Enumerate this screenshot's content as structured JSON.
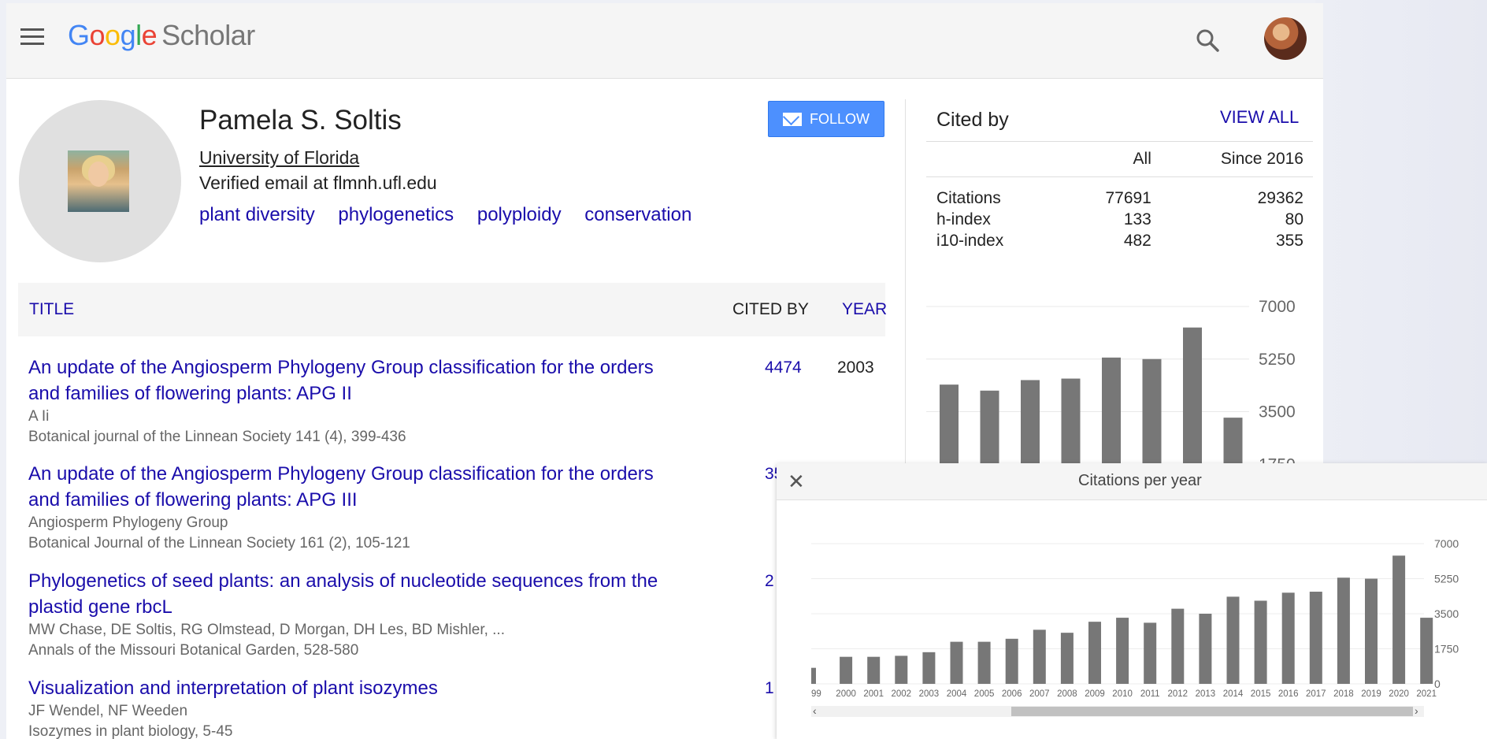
{
  "header": {
    "logo_google": [
      "G",
      "o",
      "o",
      "g",
      "l",
      "e"
    ],
    "logo_scholar": "Scholar"
  },
  "profile": {
    "name": "Pamela S. Soltis",
    "affiliation": "University of Florida",
    "email": "Verified email at flmnh.ufl.edu",
    "interests": [
      "plant diversity",
      "phylogenetics",
      "polyploidy",
      "conservation"
    ],
    "follow_label": "FOLLOW"
  },
  "articles_table": {
    "title_header": "TITLE",
    "cited_by_header": "CITED BY",
    "year_header": "YEAR",
    "rows": [
      {
        "title_line1": "An update of the Angiosperm Phylogeny Group classification for the orders",
        "title_line2": "and families of flowering plants: APG II",
        "authors": "A Ii",
        "venue": "Botanical journal of the Linnean Society 141 (4), 399-436",
        "cites": "4474",
        "year": "2003"
      },
      {
        "title_line1": "An update of the Angiosperm Phylogeny Group classification for the orders",
        "title_line2": "and families of flowering plants: APG III",
        "authors": "Angiosperm Phylogeny Group",
        "venue": "Botanical Journal of the Linnean Society 161 (2), 105-121",
        "cites": "35",
        "year": ""
      },
      {
        "title_line1": "Phylogenetics of seed plants: an analysis of nucleotide sequences from the",
        "title_line2": "plastid gene rbcL",
        "authors": "MW Chase, DE Soltis, RG Olmstead, D Morgan, DH Les, BD Mishler, ...",
        "venue": "Annals of the Missouri Botanical Garden, 528-580",
        "cites": "2",
        "year": ""
      },
      {
        "title_line1": "Visualization and interpretation of plant isozymes",
        "title_line2": "",
        "authors": "JF Wendel, NF Weeden",
        "venue": "Isozymes in plant biology, 5-45",
        "cites": "1",
        "year": ""
      }
    ]
  },
  "cited_by": {
    "title": "Cited by",
    "view_all": "VIEW ALL",
    "col_all": "All",
    "col_since": "Since 2016",
    "rows": [
      {
        "label": "Citations",
        "all": "77691",
        "since": "29362"
      },
      {
        "label": "h-index",
        "all": "133",
        "since": "80"
      },
      {
        "label": "i10-index",
        "all": "482",
        "since": "355"
      }
    ]
  },
  "popup": {
    "title": "Citations per year",
    "close_symbol": "✕",
    "scroll_left": "‹",
    "scroll_right": "›"
  },
  "chart_data": [
    {
      "type": "bar",
      "ylim": [
        0,
        7000
      ],
      "yticks": [
        7000,
        5250,
        3500,
        1750
      ],
      "values": [
        4400,
        4200,
        4550,
        4600,
        5300,
        5250,
        6300,
        3300
      ],
      "color": "#777777"
    },
    {
      "type": "bar",
      "title": "Citations per year",
      "ylim": [
        0,
        7000
      ],
      "yticks": [
        7000,
        5250,
        3500,
        1750,
        0
      ],
      "categories": [
        "99",
        "2000",
        "2001",
        "2002",
        "2003",
        "2004",
        "2005",
        "2006",
        "2007",
        "2008",
        "2009",
        "2010",
        "2011",
        "2012",
        "2013",
        "2014",
        "2015",
        "2016",
        "2017",
        "2018",
        "2019",
        "2020",
        "2021"
      ],
      "values": [
        800,
        1350,
        1350,
        1400,
        1580,
        2100,
        2100,
        2250,
        2700,
        2550,
        3100,
        3300,
        3050,
        3750,
        3500,
        4350,
        4150,
        4550,
        4600,
        5300,
        5250,
        6400,
        3300
      ],
      "color": "#777777"
    }
  ]
}
